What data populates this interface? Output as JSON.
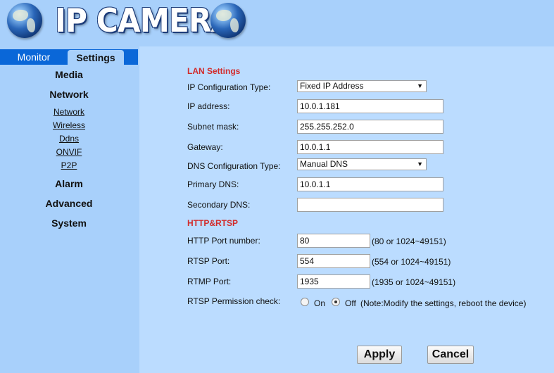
{
  "header": {
    "title": "IP CAMERA",
    "left_icon": "globe-icon",
    "right_icon": "globe-icon"
  },
  "tabs": [
    {
      "label": "Monitor",
      "active": false
    },
    {
      "label": "Settings",
      "active": true
    }
  ],
  "sidebar": {
    "groups": {
      "media": "Media",
      "network": "Network",
      "alarm": "Alarm",
      "advanced": "Advanced",
      "system": "System"
    },
    "network_items": [
      "Network",
      "Wireless",
      "Ddns",
      "ONVIF",
      "P2P"
    ]
  },
  "lan": {
    "title": "LAN Settings",
    "ip_config_type_label": "IP Configuration Type:",
    "ip_config_type_value": "Fixed IP Address",
    "ip_address_label": "IP address:",
    "ip_address_value": "10.0.1.181",
    "subnet_mask_label": "Subnet mask:",
    "subnet_mask_value": "255.255.252.0",
    "gateway_label": "Gateway:",
    "gateway_value": "10.0.1.1",
    "dns_config_type_label": "DNS Configuration Type:",
    "dns_config_type_value": "Manual DNS",
    "primary_dns_label": "Primary DNS:",
    "primary_dns_value": "10.0.1.1",
    "secondary_dns_label": "Secondary DNS:",
    "secondary_dns_value": ""
  },
  "http_rtsp": {
    "title": "HTTP&RTSP",
    "http_port_label": "HTTP Port number:",
    "http_port_value": "80",
    "http_port_hint": "(80 or 1024~49151)",
    "rtsp_port_label": "RTSP Port:",
    "rtsp_port_value": "554",
    "rtsp_port_hint": "(554 or 1024~49151)",
    "rtmp_port_label": "RTMP Port:",
    "rtmp_port_value": "1935",
    "rtmp_port_hint": "(1935 or 1024~49151)",
    "rtsp_permission_label": "RTSP Permission check:",
    "on_label": "On",
    "off_label": "Off",
    "selected": "Off",
    "note": "(Note:Modify the settings, reboot the device)"
  },
  "buttons": {
    "apply": "Apply",
    "cancel": "Cancel"
  },
  "colors": {
    "background": "#a8d0fb",
    "panel": "#bbdcff",
    "tab_bar": "#0a67d8",
    "section_title": "#d22b2b"
  }
}
